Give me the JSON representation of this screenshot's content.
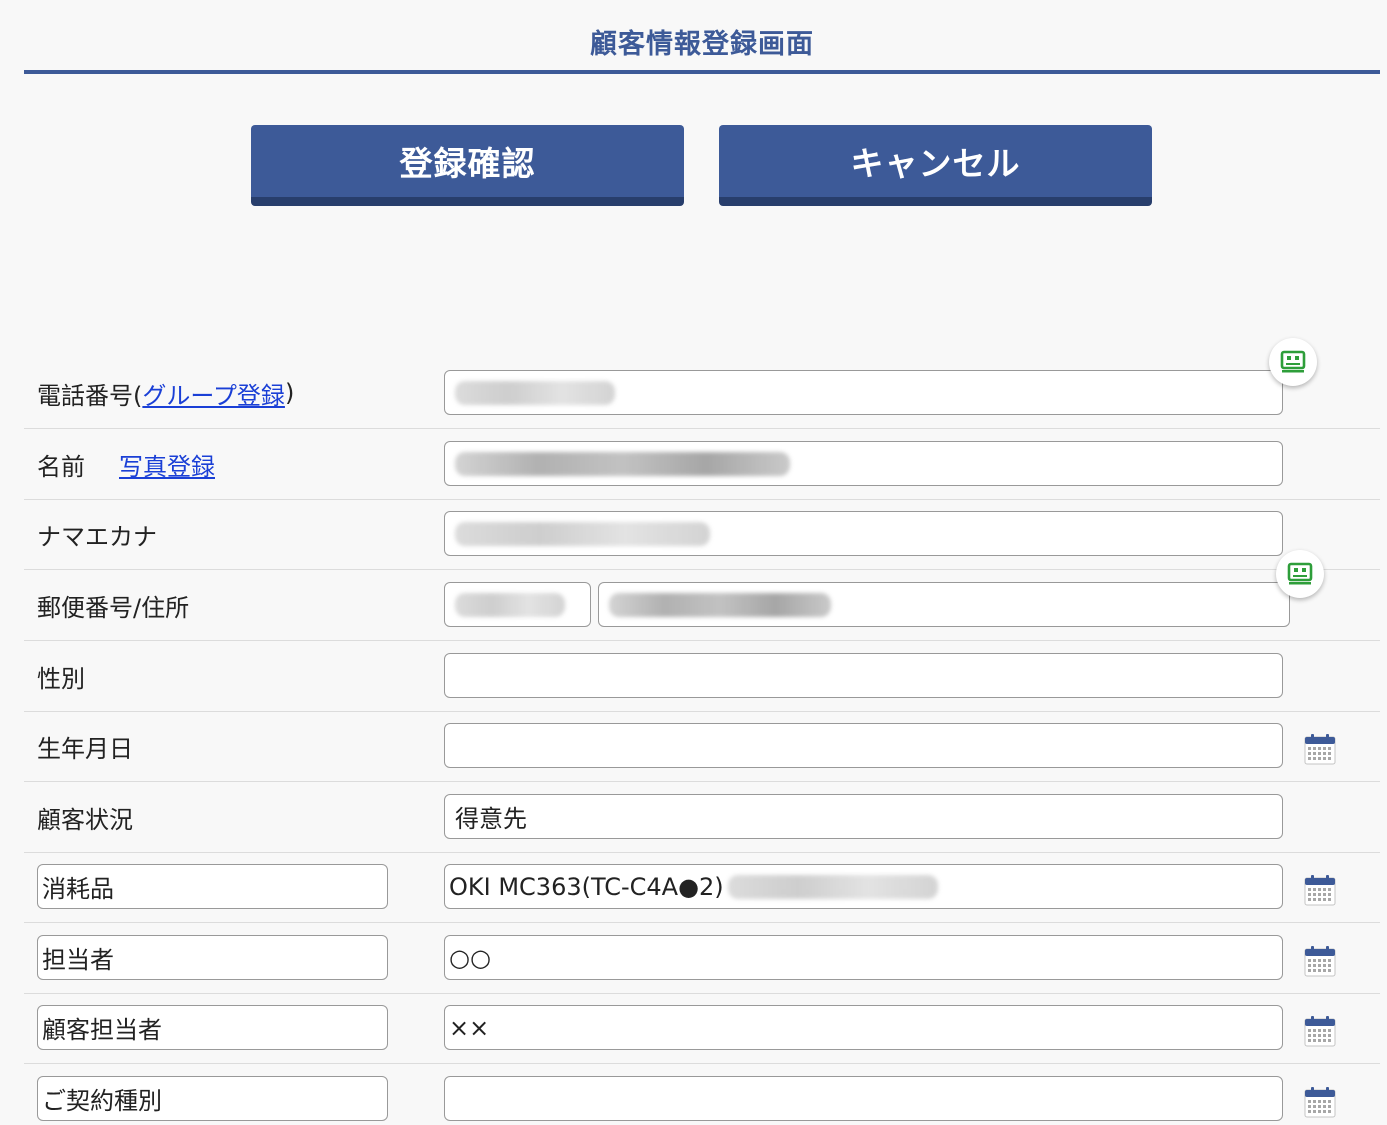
{
  "header": {
    "title": "顧客情報登録画面"
  },
  "buttons": {
    "confirm_label": "登録確認",
    "cancel_label": "キャンセル"
  },
  "form": {
    "phone": {
      "label_prefix": "電話番号(",
      "link": "グループ登録",
      "label_suffix": ")"
    },
    "name": {
      "label": "名前",
      "link": "写真登録"
    },
    "kana": {
      "label": "ナマエカナ"
    },
    "address": {
      "label": "郵便番号/住所"
    },
    "gender": {
      "label": "性別",
      "value": ""
    },
    "birthday": {
      "label": "生年月日",
      "value": ""
    },
    "status": {
      "label": "顧客状況",
      "value": "得意先"
    },
    "custom_rows": [
      {
        "label": "消耗品",
        "value": "OKI MC363(TC-C4A●2)"
      },
      {
        "label": "担当者",
        "value": "○○"
      },
      {
        "label": "顧客担当者",
        "value": "××"
      },
      {
        "label": "ご契約種別",
        "value": ""
      }
    ]
  },
  "colors": {
    "accent": "#3d5a98",
    "accent_dark": "#283e6c",
    "link": "#1a3fd6",
    "chip_icon": "#2e9e3a"
  },
  "icons": {
    "contact_chip": "contact-card-icon",
    "calendar": "calendar-icon"
  }
}
